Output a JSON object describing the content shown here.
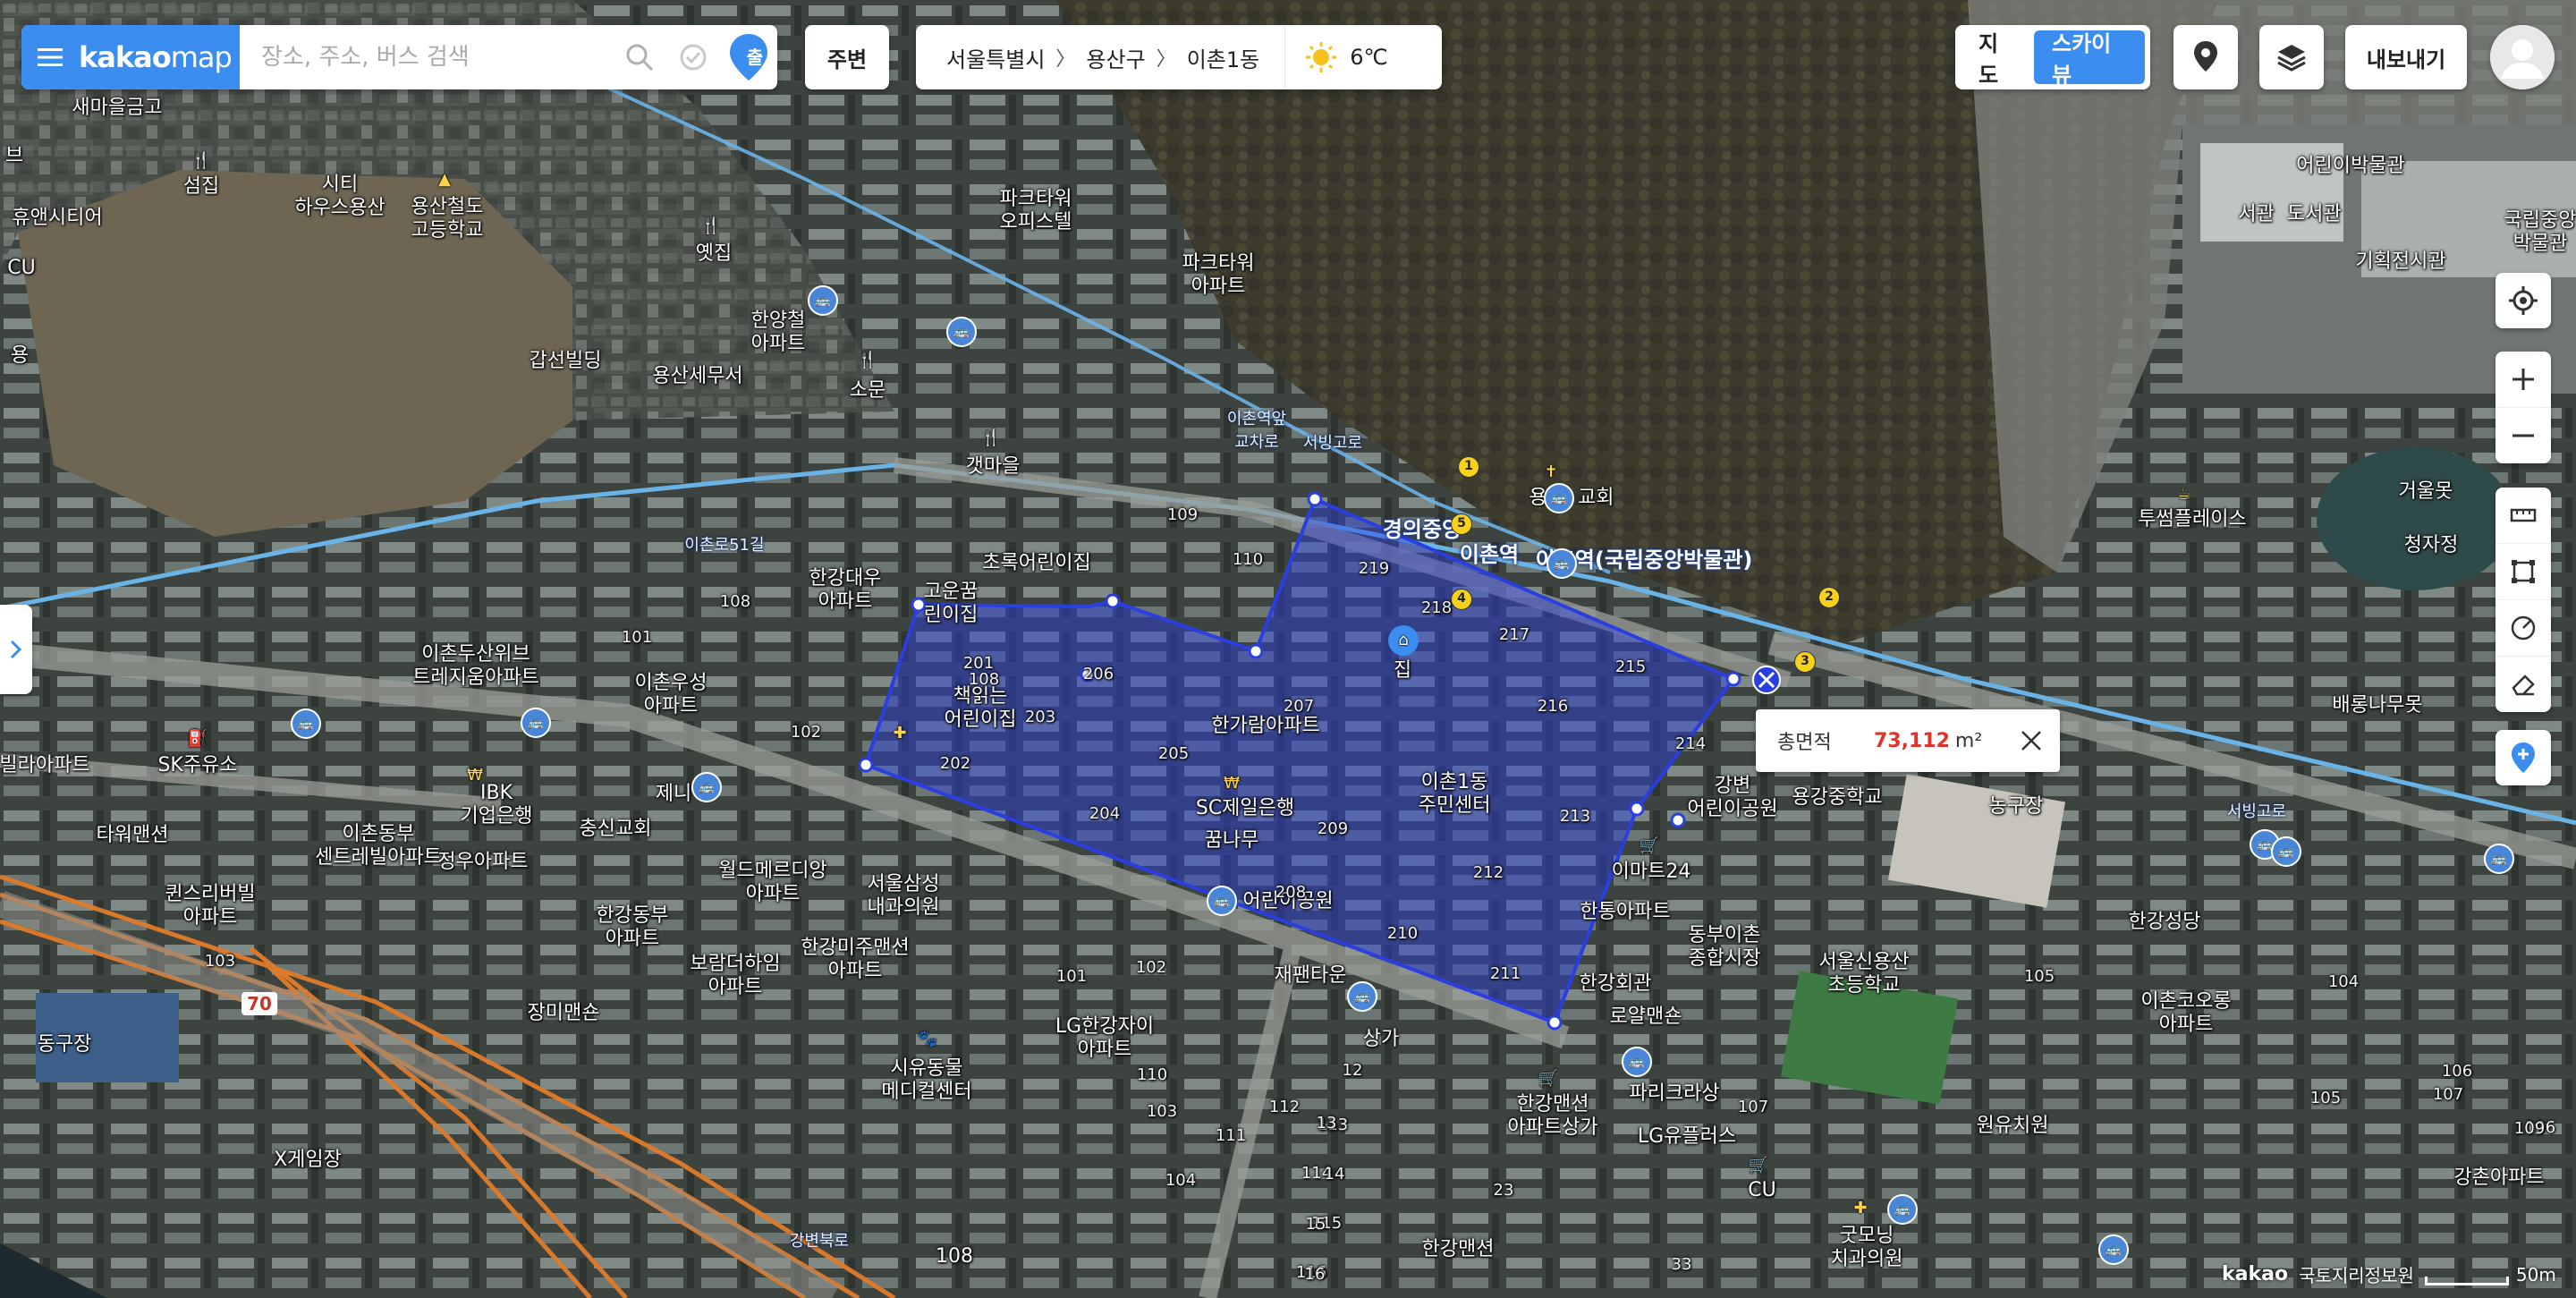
{
  "app": {
    "brand_bold": "kakao",
    "brand_light": "map",
    "search_placeholder": "장소, 주소, 버스 검색",
    "directions_label": "출",
    "nearby_label": "주변"
  },
  "breadcrumb": {
    "items": [
      "서울특별시",
      "용산구",
      "이촌1동"
    ],
    "weather_temp": "6℃",
    "weather_icon": "sun-icon"
  },
  "map_type": {
    "options": [
      "지도",
      "스카이뷰"
    ],
    "selected": "스카이뷰"
  },
  "toolbar": {
    "export_label": "내보내기"
  },
  "measurement": {
    "label": "총면적",
    "value": "73,112",
    "unit": "m²"
  },
  "attribution": {
    "provider": "kakao",
    "source": "국토지리정보원",
    "scale": "50m"
  },
  "colors": {
    "accent": "#3b8ef0",
    "polygon_stroke": "#2a3fe0",
    "polygon_fill": "#2a3fe0",
    "area_value": "#e0322b",
    "subway_line": "#6ab3e6",
    "highway": "#e07b2a"
  },
  "map_labels": [
    {
      "text": "새마을금고"
    },
    {
      "text": "섬집"
    },
    {
      "text": "시티\n하우스용산"
    },
    {
      "text": "용산철도\n고등학교"
    },
    {
      "text": "휴앤시티어"
    },
    {
      "text": "CU"
    },
    {
      "text": "옛집"
    },
    {
      "text": "한양철\n아파트"
    },
    {
      "text": "용산세무서"
    },
    {
      "text": "갑선빌딩"
    },
    {
      "text": "소문"
    },
    {
      "text": "갯마을"
    },
    {
      "text": "파크타워\n오피스텔"
    },
    {
      "text": "파크타워\n아파트"
    },
    {
      "text": "이촌역앞\n교차로"
    },
    {
      "text": "서빙고로"
    },
    {
      "text": "용산  교회"
    },
    {
      "text": "이촌역"
    },
    {
      "text": "이촌역(국립중앙박물관)"
    },
    {
      "text": "경의중앙"
    },
    {
      "text": "어린이박물관"
    },
    {
      "text": "서관  도서관"
    },
    {
      "text": "기획전시관"
    },
    {
      "text": "국립중앙\n박물관"
    },
    {
      "text": "거울못"
    },
    {
      "text": "청자정"
    },
    {
      "text": "투썸플레이스"
    },
    {
      "text": "배롱나무못"
    },
    {
      "text": "이촌로51길"
    },
    {
      "text": "한강대우\n아파트"
    },
    {
      "text": "고운꿈\n린이집"
    },
    {
      "text": "초록어린이집"
    },
    {
      "text": "이촌두산위브\n트레지움아파트"
    },
    {
      "text": "이촌우성\n아파트"
    },
    {
      "text": "책읽는\n어린이집"
    },
    {
      "text": "한가람아파트"
    },
    {
      "text": "이촌1동\n주민센터"
    },
    {
      "text": "SC제일은행"
    },
    {
      "text": "집"
    },
    {
      "text": "SK주유소"
    },
    {
      "text": "IBK\n기업은행"
    },
    {
      "text": "제니"
    },
    {
      "text": "충신교회"
    },
    {
      "text": "이촌동부\n센트레빌아파트"
    },
    {
      "text": "타워맨션"
    },
    {
      "text": "정우아파트"
    },
    {
      "text": "퀸스리버빌\n아파트"
    },
    {
      "text": "월드메르디앙\n아파트"
    },
    {
      "text": "서울삼성\n내과의원"
    },
    {
      "text": "한강동부\n아파트"
    },
    {
      "text": "한강미주맨션\n아파트"
    },
    {
      "text": "보람더하임\n아파트"
    },
    {
      "text": "장미맨숀"
    },
    {
      "text": "동구장"
    },
    {
      "text": "X게임장"
    },
    {
      "text": "시유동물\n메디컬센터"
    },
    {
      "text": "LG한강자이\n아파트"
    },
    {
      "text": "재팬타운"
    },
    {
      "text": "상가"
    },
    {
      "text": "이마트24"
    },
    {
      "text": "한통아파트"
    },
    {
      "text": "동부이촌\n종합시장"
    },
    {
      "text": "한강회관"
    },
    {
      "text": "로얄맨숀"
    },
    {
      "text": "파리크라상"
    },
    {
      "text": "한강맨션\n아파트상가"
    },
    {
      "text": "LG유플러스"
    },
    {
      "text": "CU"
    },
    {
      "text": "한강맨션"
    },
    {
      "text": "굿모닝\n치과의원"
    },
    {
      "text": "강변\n어린이공원"
    },
    {
      "text": "용강중학교"
    },
    {
      "text": "농구장"
    },
    {
      "text": "서울신용산\n초등학교"
    },
    {
      "text": "한강성당"
    },
    {
      "text": "이촌코오롱\n아파트"
    },
    {
      "text": "원유치원"
    },
    {
      "text": "강촌아파트"
    },
    {
      "text": "서빙고로"
    },
    {
      "text": "강변북로"
    },
    {
      "text": "어린이공원"
    },
    {
      "text": "꿈나무"
    },
    {
      "text": "70"
    },
    {
      "text": "브"
    },
    {
      "text": "용"
    },
    {
      "text": "빌라아파트"
    },
    {
      "text": "108"
    }
  ],
  "building_numbers": [
    "219",
    "217",
    "215",
    "216",
    "214",
    "218",
    "206",
    "207",
    "205",
    "203",
    "202",
    "201",
    "204",
    "209",
    "208",
    "210",
    "211",
    "212",
    "213",
    "109",
    "110",
    "108",
    "101",
    "102",
    "103",
    "104",
    "105",
    "106",
    "107",
    "110",
    "111",
    "112",
    "113",
    "114",
    "115",
    "116",
    "12",
    "13",
    "14",
    "15",
    "16",
    "23",
    "33",
    "101",
    "102",
    "103",
    "104",
    "105",
    "106",
    "107",
    "108",
    "109"
  ]
}
